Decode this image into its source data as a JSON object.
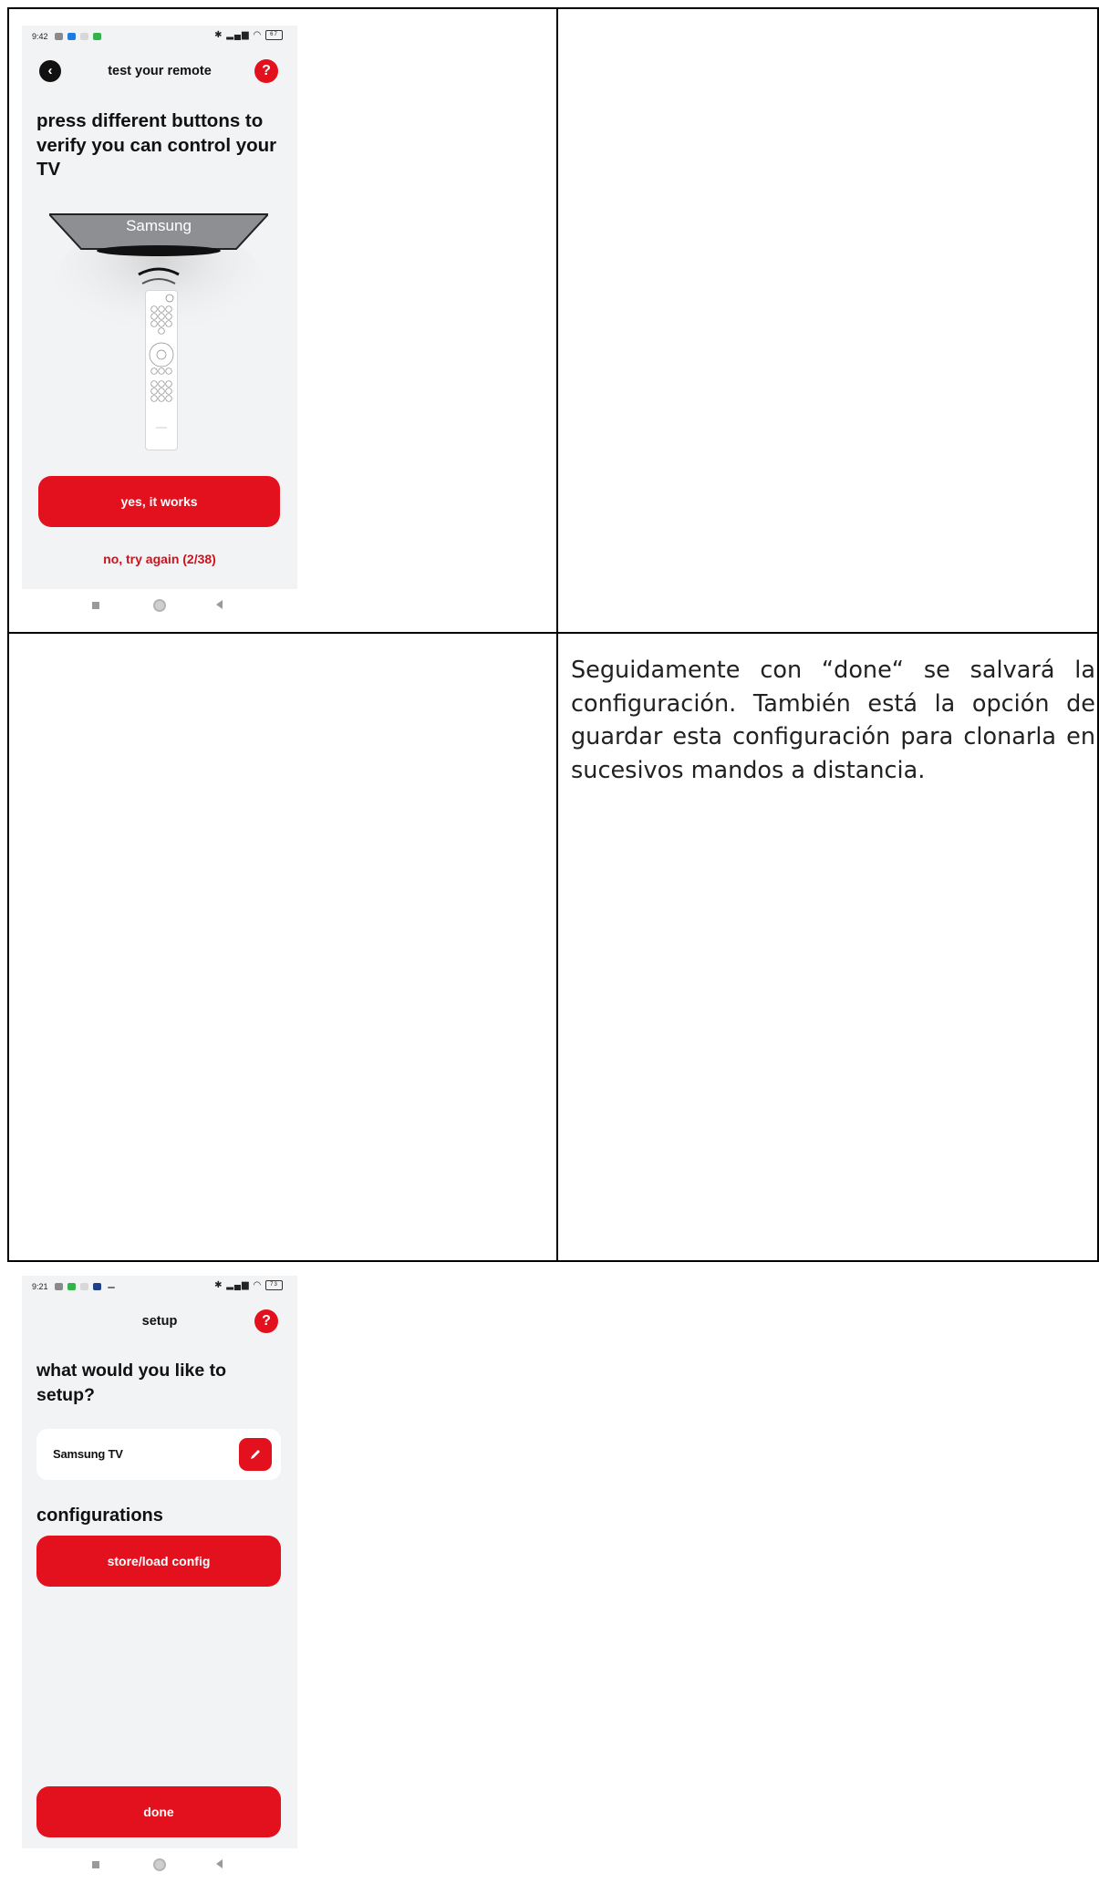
{
  "screen1": {
    "status": {
      "time": "9:42",
      "battery": "67"
    },
    "appbar": {
      "title": "test your remote",
      "back_icon": "chevron-left-icon",
      "help_icon": "?"
    },
    "headline": "press different buttons to verify you can control your TV",
    "tv_label": "Samsung",
    "primary_button": "yes, it works",
    "secondary_link": "no, try again (2/38)"
  },
  "screen2": {
    "status": {
      "time": "9:21",
      "battery": "73"
    },
    "appbar": {
      "title": "setup",
      "help_icon": "?"
    },
    "headline": "what would you like to setup?",
    "device": {
      "name": "Samsung TV",
      "edit_icon": "pencil-icon"
    },
    "section_title": "configurations",
    "config_button": "store/load config",
    "done_button": "done"
  },
  "description": "Seguidamente con “done“ se salvará la configuración. También está la opción de guardar esta configuración para clonarla en sucesivos mandos a distancia.",
  "colors": {
    "accent": "#e3101e",
    "background": "#f2f3f4"
  }
}
